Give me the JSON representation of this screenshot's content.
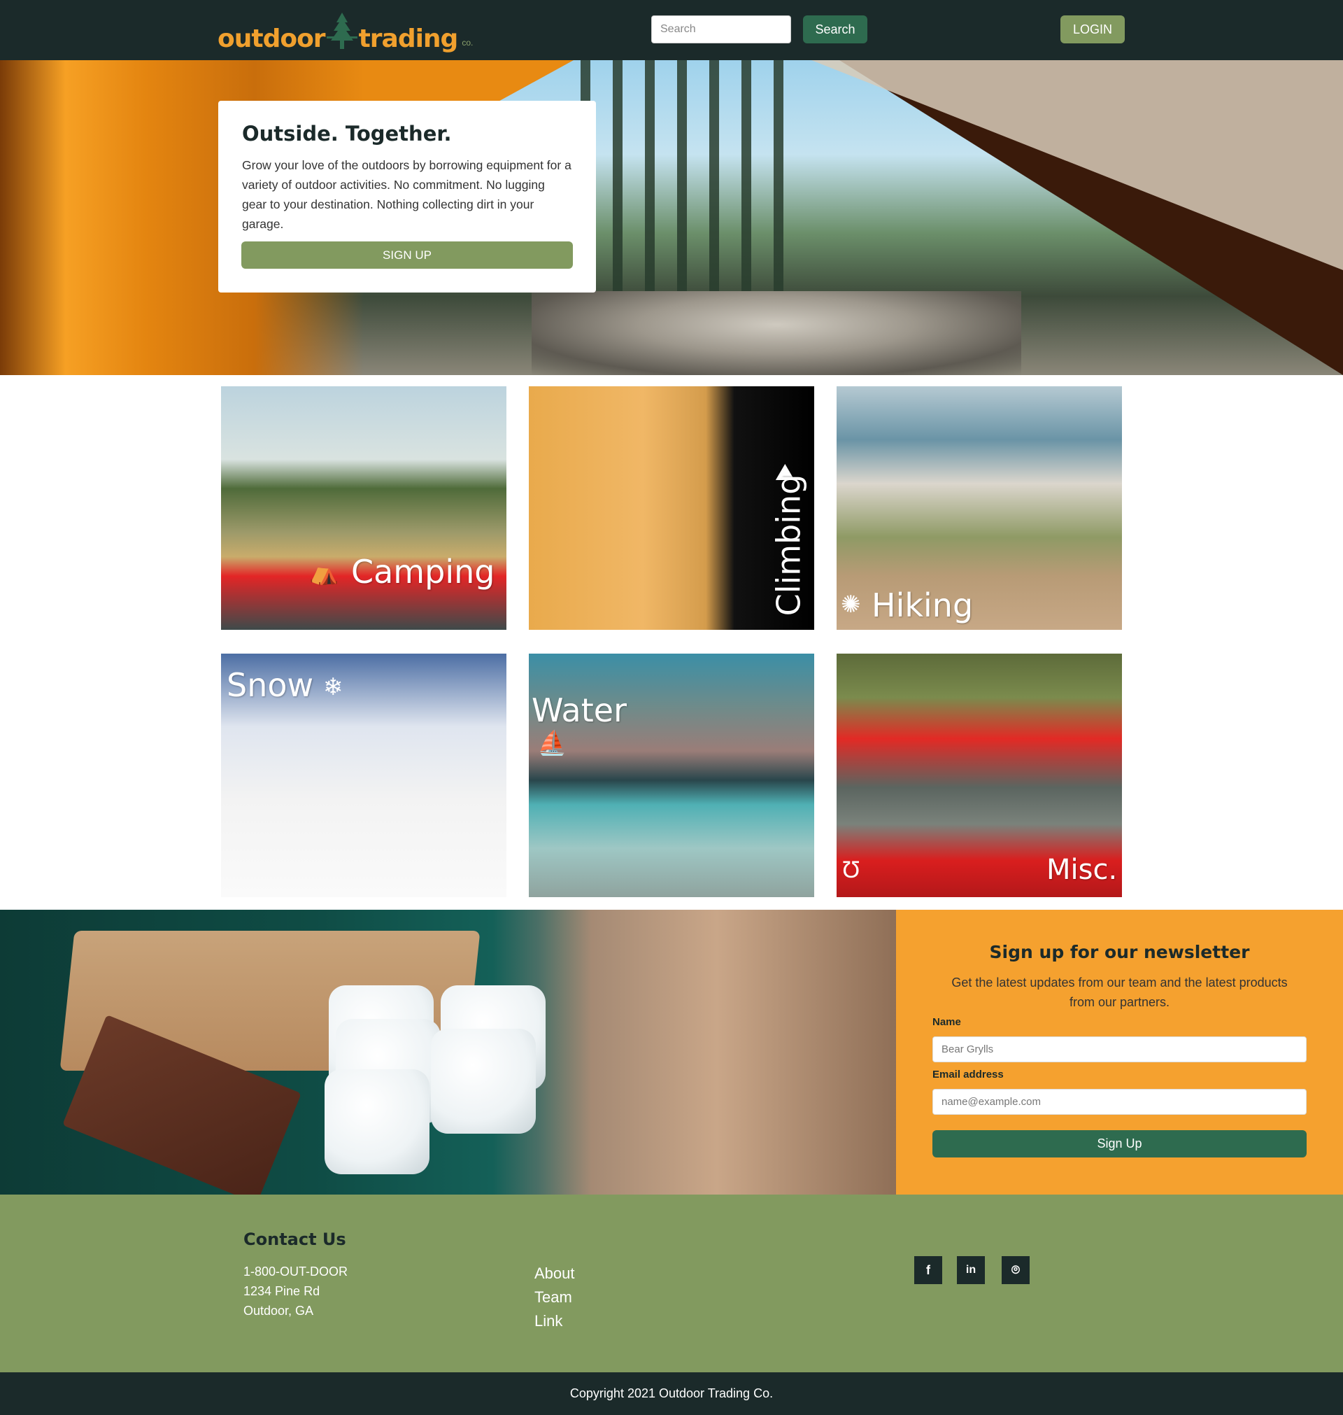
{
  "nav": {
    "logo_left": "outdoor",
    "logo_right": "trading",
    "logo_co": "co.",
    "search_placeholder": "Search",
    "search_button": "Search",
    "login_button": "LOGIN"
  },
  "hero": {
    "title": "Outside. Together.",
    "text": "Grow your love of the outdoors by borrowing equipment for a variety of outdoor activities. No commitment. No lugging gear to your destination. Nothing collecting dirt in your garage.",
    "signup_button": "SIGN UP"
  },
  "categories": [
    {
      "label": "Camping",
      "icon": "tent-icon"
    },
    {
      "label": "Climbing",
      "icon": "mountain-icon"
    },
    {
      "label": "Hiking",
      "icon": "compass-icon"
    },
    {
      "label": "Snow",
      "icon": "snowflake-icon"
    },
    {
      "label": "Water",
      "icon": "kayak-icon"
    },
    {
      "label": "Misc.",
      "icon": "horseshoe-icon"
    }
  ],
  "newsletter": {
    "title": "Sign up for our newsletter",
    "description": "Get the latest updates from our team and the latest products from our partners.",
    "name_label": "Name",
    "name_placeholder": "Bear Grylls",
    "email_label": "Email address",
    "email_placeholder": "name@example.com",
    "submit_button": "Sign Up"
  },
  "footer": {
    "contact_title": "Contact Us",
    "phone": "1-800-OUT-DOOR",
    "address_line1": "1234 Pine Rd",
    "address_line2": "Outdoor, GA",
    "links": [
      "About",
      "Team",
      "Link"
    ],
    "social": [
      {
        "name": "facebook-icon",
        "glyph": "f"
      },
      {
        "name": "linkedin-icon",
        "glyph": "in"
      },
      {
        "name": "github-icon",
        "glyph": "⌾"
      }
    ],
    "copyright": "Copyright 2021 Outdoor Trading Co."
  },
  "colors": {
    "navbar": "#1b2a2a",
    "brand_orange": "#f0a02e",
    "olive_green": "#829a5f",
    "dark_green": "#2e6b4f",
    "newsletter_bg": "#f5a12f"
  }
}
